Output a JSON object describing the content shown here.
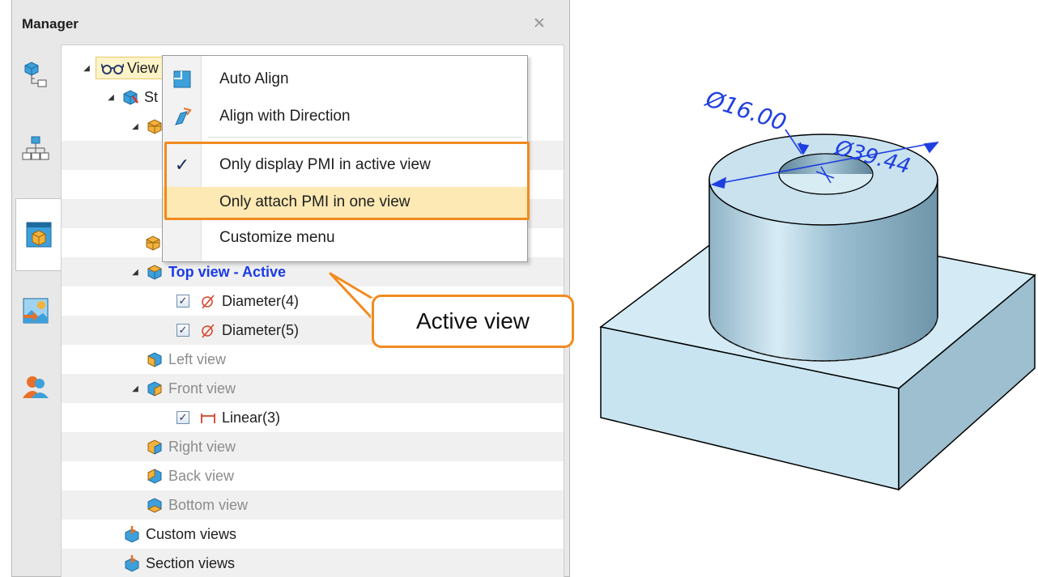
{
  "manager": {
    "title": "Manager",
    "close_icon": "close-icon"
  },
  "side_tabs": [
    {
      "name": "assembly-tree-tab",
      "icon": "assembly-tree-icon"
    },
    {
      "name": "hierarchy-tab",
      "icon": "hierarchy-icon"
    },
    {
      "name": "view-manager-tab",
      "icon": "view-cube-icon",
      "active": true
    },
    {
      "name": "image-tab",
      "icon": "image-import-icon"
    },
    {
      "name": "users-tab",
      "icon": "users-icon"
    }
  ],
  "tree": {
    "root_label": "View",
    "standard_label": "St",
    "top_view": "Top view - Active",
    "diameter4": "Diameter(4)",
    "diameter5": "Diameter(5)",
    "left_view": "Left view",
    "front_view": "Front view",
    "linear3": "Linear(3)",
    "right_view": "Right view",
    "back_view": "Back view",
    "bottom_view": "Bottom view",
    "custom_views": "Custom views",
    "section_views": "Section views"
  },
  "context_menu": {
    "auto_align": "Auto Align",
    "align_direction": "Align with Direction",
    "only_display": "Only display PMI in active view",
    "only_attach": "Only attach PMI in one view",
    "customize": "Customize menu",
    "checked_mark": "✓"
  },
  "callout": {
    "text": "Active view"
  },
  "model": {
    "dim_small": "Ø16.00",
    "dim_large": "Ø39.44"
  },
  "colors": {
    "highlight_orange": "#f28a1f",
    "active_blue": "#1a3be6",
    "menu_hover": "#fce9b4",
    "pmi_blue": "#1f3fe0"
  }
}
